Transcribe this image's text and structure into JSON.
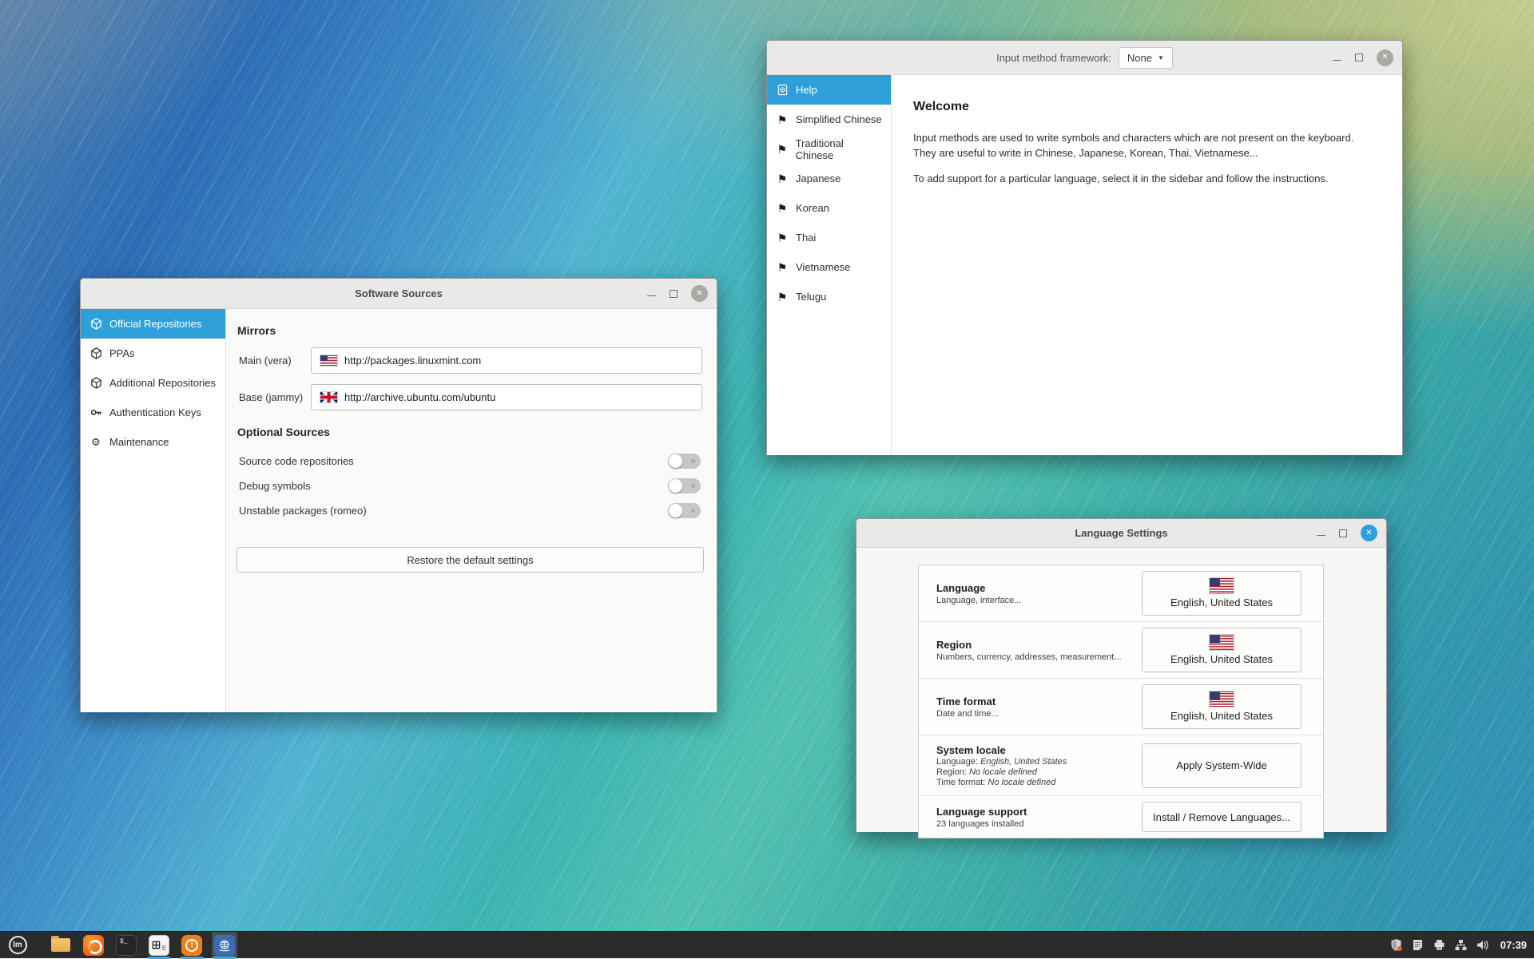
{
  "icons": {
    "close": "✕",
    "caret_down": "▼",
    "flag": "⚑",
    "gear": "⚙",
    "menu_logo": "lm",
    "terminal_glyph": "$_",
    "im_glyph_sub": "E",
    "info_glyph": "i"
  },
  "im_window": {
    "titlebar_label": "Input method framework:",
    "dropdown_value": "None",
    "sidebar": {
      "items": [
        {
          "label": "Help",
          "selected": true
        },
        {
          "label": "Simplified Chinese"
        },
        {
          "label": "Traditional Chinese"
        },
        {
          "label": "Japanese"
        },
        {
          "label": "Korean"
        },
        {
          "label": "Thai"
        },
        {
          "label": "Vietnamese"
        },
        {
          "label": "Telugu"
        }
      ]
    },
    "content": {
      "heading": "Welcome",
      "paragraph1_line1": "Input methods are used to write symbols and characters which are not present on the keyboard.",
      "paragraph1_line2": "They are useful to write in Chinese, Japanese, Korean, Thai, Vietnamese...",
      "paragraph2": "To add support for a particular language, select it in the sidebar and follow the instructions."
    }
  },
  "ss_window": {
    "title": "Software Sources",
    "sidebar": {
      "items": [
        {
          "label": "Official Repositories",
          "selected": true
        },
        {
          "label": "PPAs"
        },
        {
          "label": "Additional Repositories"
        },
        {
          "label": "Authentication Keys"
        },
        {
          "label": "Maintenance"
        }
      ]
    },
    "mirrors": {
      "heading": "Mirrors",
      "main_label": "Main (vera)",
      "main_url": "http://packages.linuxmint.com",
      "base_label": "Base (jammy)",
      "base_url": "http://archive.ubuntu.com/ubuntu"
    },
    "optional_sources": {
      "heading": "Optional Sources",
      "toggles": [
        {
          "label": "Source code repositories",
          "state": "off"
        },
        {
          "label": "Debug symbols",
          "state": "off"
        },
        {
          "label": "Unstable packages (romeo)",
          "state": "off"
        }
      ]
    },
    "restore_button_label": "Restore the default settings"
  },
  "ls_window": {
    "title": "Language Settings",
    "rows": [
      {
        "title": "Language",
        "subtitle": "Language, interface...",
        "button_label": "English, United States"
      },
      {
        "title": "Region",
        "subtitle": "Numbers, currency, addresses, measurement...",
        "button_label": "English, United States"
      },
      {
        "title": "Time format",
        "subtitle": "Date and time...",
        "button_label": "English, United States"
      },
      {
        "title": "System locale",
        "line1_label": "Language:",
        "line1_value": "English, United States",
        "line2_label": "Region:",
        "line2_value": "No locale defined",
        "line3_label": "Time format:",
        "line3_value": "No locale defined",
        "button_label": "Apply System-Wide"
      },
      {
        "title": "Language support",
        "subtitle": "23 languages installed",
        "button_label": "Install / Remove Languages..."
      }
    ]
  },
  "taskbar": {
    "clock": "07:39"
  }
}
